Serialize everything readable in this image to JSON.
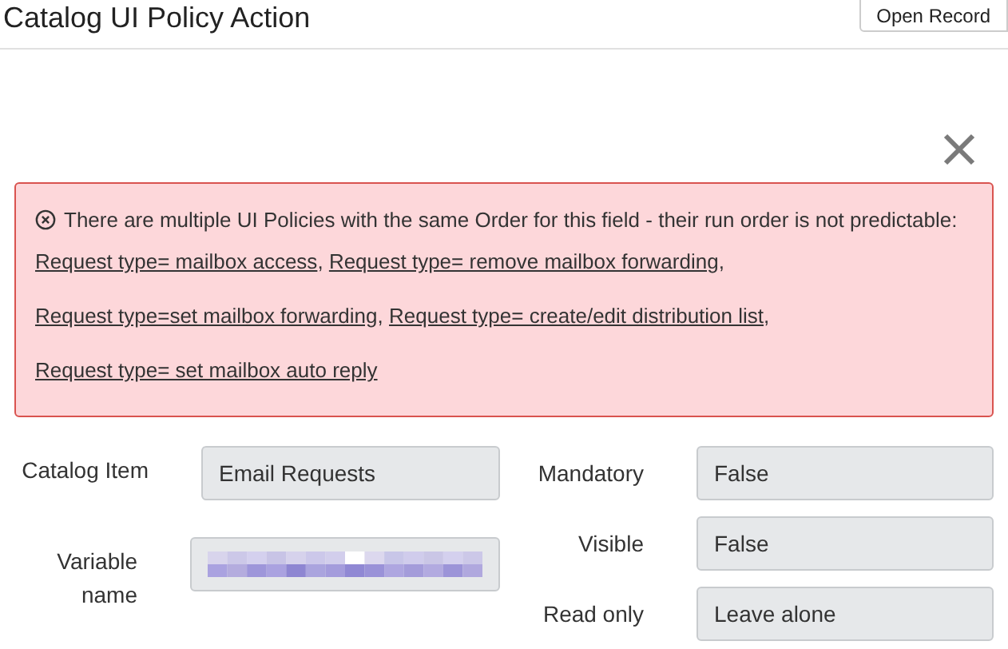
{
  "header": {
    "title": "Catalog UI Policy Action",
    "button": "Open Record"
  },
  "alert": {
    "lines": [
      {
        "text": "There are multiple UI Policies with the same Order for this field - their run order is not predictable:",
        "links": [
          {
            "label": "Request type= mailbox access",
            "separator": ","
          },
          {
            "label": "Request type= remove mailbox forwarding",
            "separator": ","
          }
        ]
      },
      {
        "links": [
          {
            "label": "Request type=set mailbox forwarding",
            "separator": ","
          },
          {
            "label": "Request type= create/edit distribution list",
            "separator": ","
          }
        ]
      },
      {
        "links": [
          {
            "label": "Request type= set mailbox auto reply"
          }
        ]
      }
    ]
  },
  "left_fields": [
    {
      "label": "Catalog Item",
      "value": "Email Requests",
      "redacted": false
    },
    {
      "label": "Variable name",
      "redacted": true
    }
  ],
  "right_fields": [
    {
      "label": "Mandatory",
      "value": "False"
    },
    {
      "label": "Visible",
      "value": "False"
    },
    {
      "label": "Read only",
      "value": "Leave alone"
    }
  ]
}
